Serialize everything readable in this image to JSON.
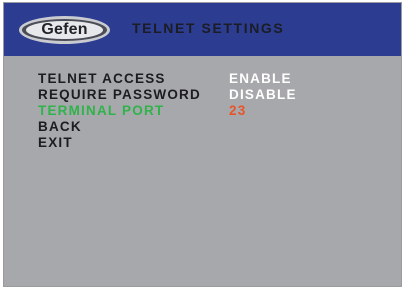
{
  "header": {
    "logo_text": "Gefen",
    "title": "TELNET SETTINGS"
  },
  "menu": {
    "items": [
      {
        "label": "TELNET ACCESS",
        "value": "ENABLE"
      },
      {
        "label": "REQUIRE PASSWORD",
        "value": "DISABLE"
      },
      {
        "label": "TERMINAL PORT",
        "value": "23"
      },
      {
        "label": "BACK",
        "value": ""
      },
      {
        "label": "EXIT",
        "value": ""
      }
    ],
    "selected_index": 2
  },
  "colors": {
    "header_bg": "#2c3c91",
    "body_bg": "#a7a8ab",
    "selected_label": "#2fb34a",
    "selected_value": "#e8542a",
    "value_text": "#ffffff",
    "label_text": "#1c1d20"
  }
}
